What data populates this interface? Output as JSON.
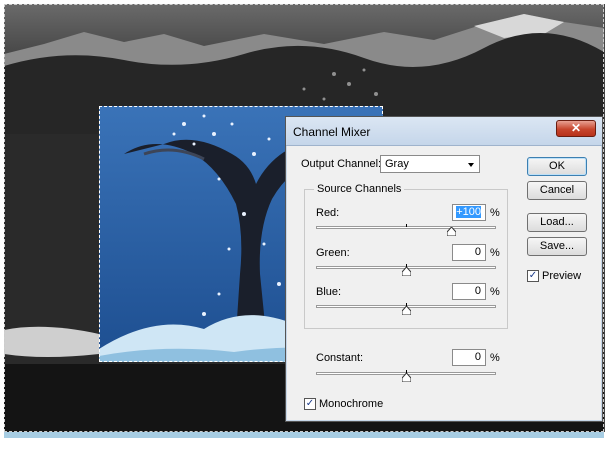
{
  "dialog": {
    "title": "Channel Mixer",
    "close_glyph": "✕",
    "output_channel": {
      "label": "Output Channel:",
      "value": "Gray"
    },
    "source_channels": {
      "title": "Source Channels",
      "channels": [
        {
          "label": "Red:",
          "value": "+100",
          "unit": "%",
          "slider_percent": 100
        },
        {
          "label": "Green:",
          "value": "0",
          "unit": "%",
          "slider_percent": 0
        },
        {
          "label": "Blue:",
          "value": "0",
          "unit": "%",
          "slider_percent": 0
        }
      ]
    },
    "constant": {
      "label": "Constant:",
      "value": "0",
      "unit": "%",
      "slider_percent": 0
    },
    "monochrome": {
      "label": "Monochrome",
      "checked": true
    },
    "buttons": {
      "ok": "OK",
      "cancel": "Cancel",
      "load": "Load...",
      "save": "Save..."
    },
    "preview": {
      "label": "Preview",
      "checked": true
    }
  },
  "colors": {
    "accent": "#3399ff",
    "sea_blue": "#2f5f9e",
    "bottom_strip": "#a7cde3"
  }
}
